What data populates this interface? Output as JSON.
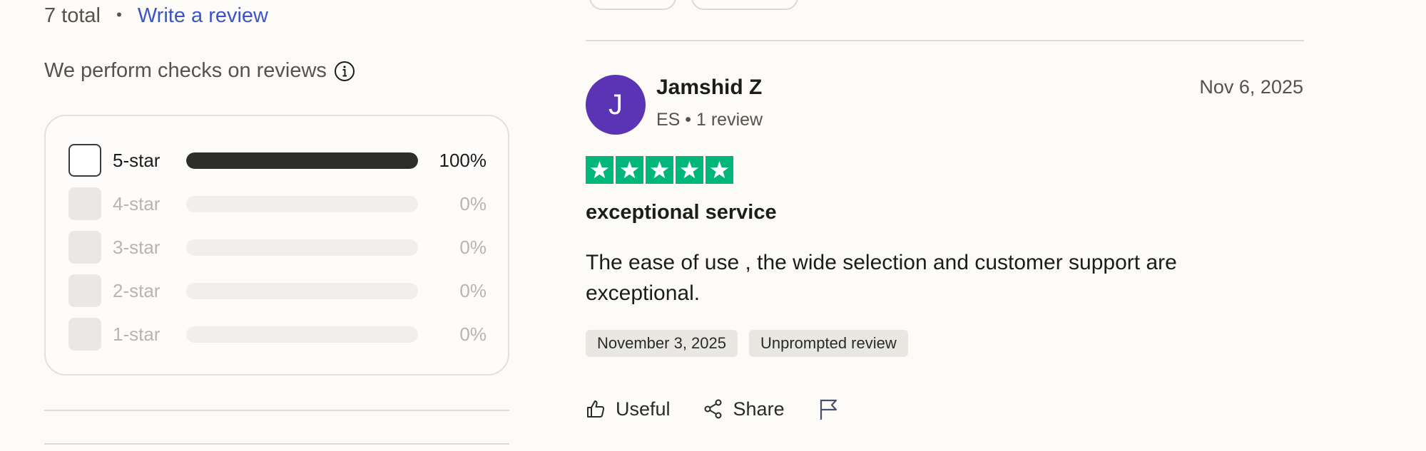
{
  "summary": {
    "total_text": "7 total",
    "separator": "•",
    "write_review_label": "Write a review",
    "checks_text": "We perform checks on reviews"
  },
  "rating_filter": [
    {
      "label": "5-star",
      "percent_text": "100%",
      "fill": 1.0,
      "enabled": true
    },
    {
      "label": "4-star",
      "percent_text": "0%",
      "fill": 0,
      "enabled": false
    },
    {
      "label": "3-star",
      "percent_text": "0%",
      "fill": 0,
      "enabled": false
    },
    {
      "label": "2-star",
      "percent_text": "0%",
      "fill": 0,
      "enabled": false
    },
    {
      "label": "1-star",
      "percent_text": "0%",
      "fill": 0,
      "enabled": false
    }
  ],
  "review": {
    "avatar_initial": "J",
    "avatar_color": "#5a34b4",
    "reviewer_name": "Jamshid Z",
    "reviewer_meta": "ES • 1 review",
    "date": "Nov 6, 2025",
    "rating": 5,
    "star_color": "#00b67a",
    "title": "exceptional service",
    "body": "The ease of use , the wide selection and customer support are exceptional.",
    "tags": [
      "November 3, 2025",
      "Unprompted review"
    ],
    "actions": {
      "useful_label": "Useful",
      "share_label": "Share"
    }
  },
  "colors": {
    "link": "#3d55c4",
    "bar_fill": "#2d2d2b",
    "bar_track": "#f1efeb",
    "background": "#fcfbf8"
  },
  "icons": {
    "info": "info-icon",
    "star": "star-icon",
    "useful": "thumbs-up-icon",
    "share": "share-icon",
    "report": "flag-icon"
  }
}
